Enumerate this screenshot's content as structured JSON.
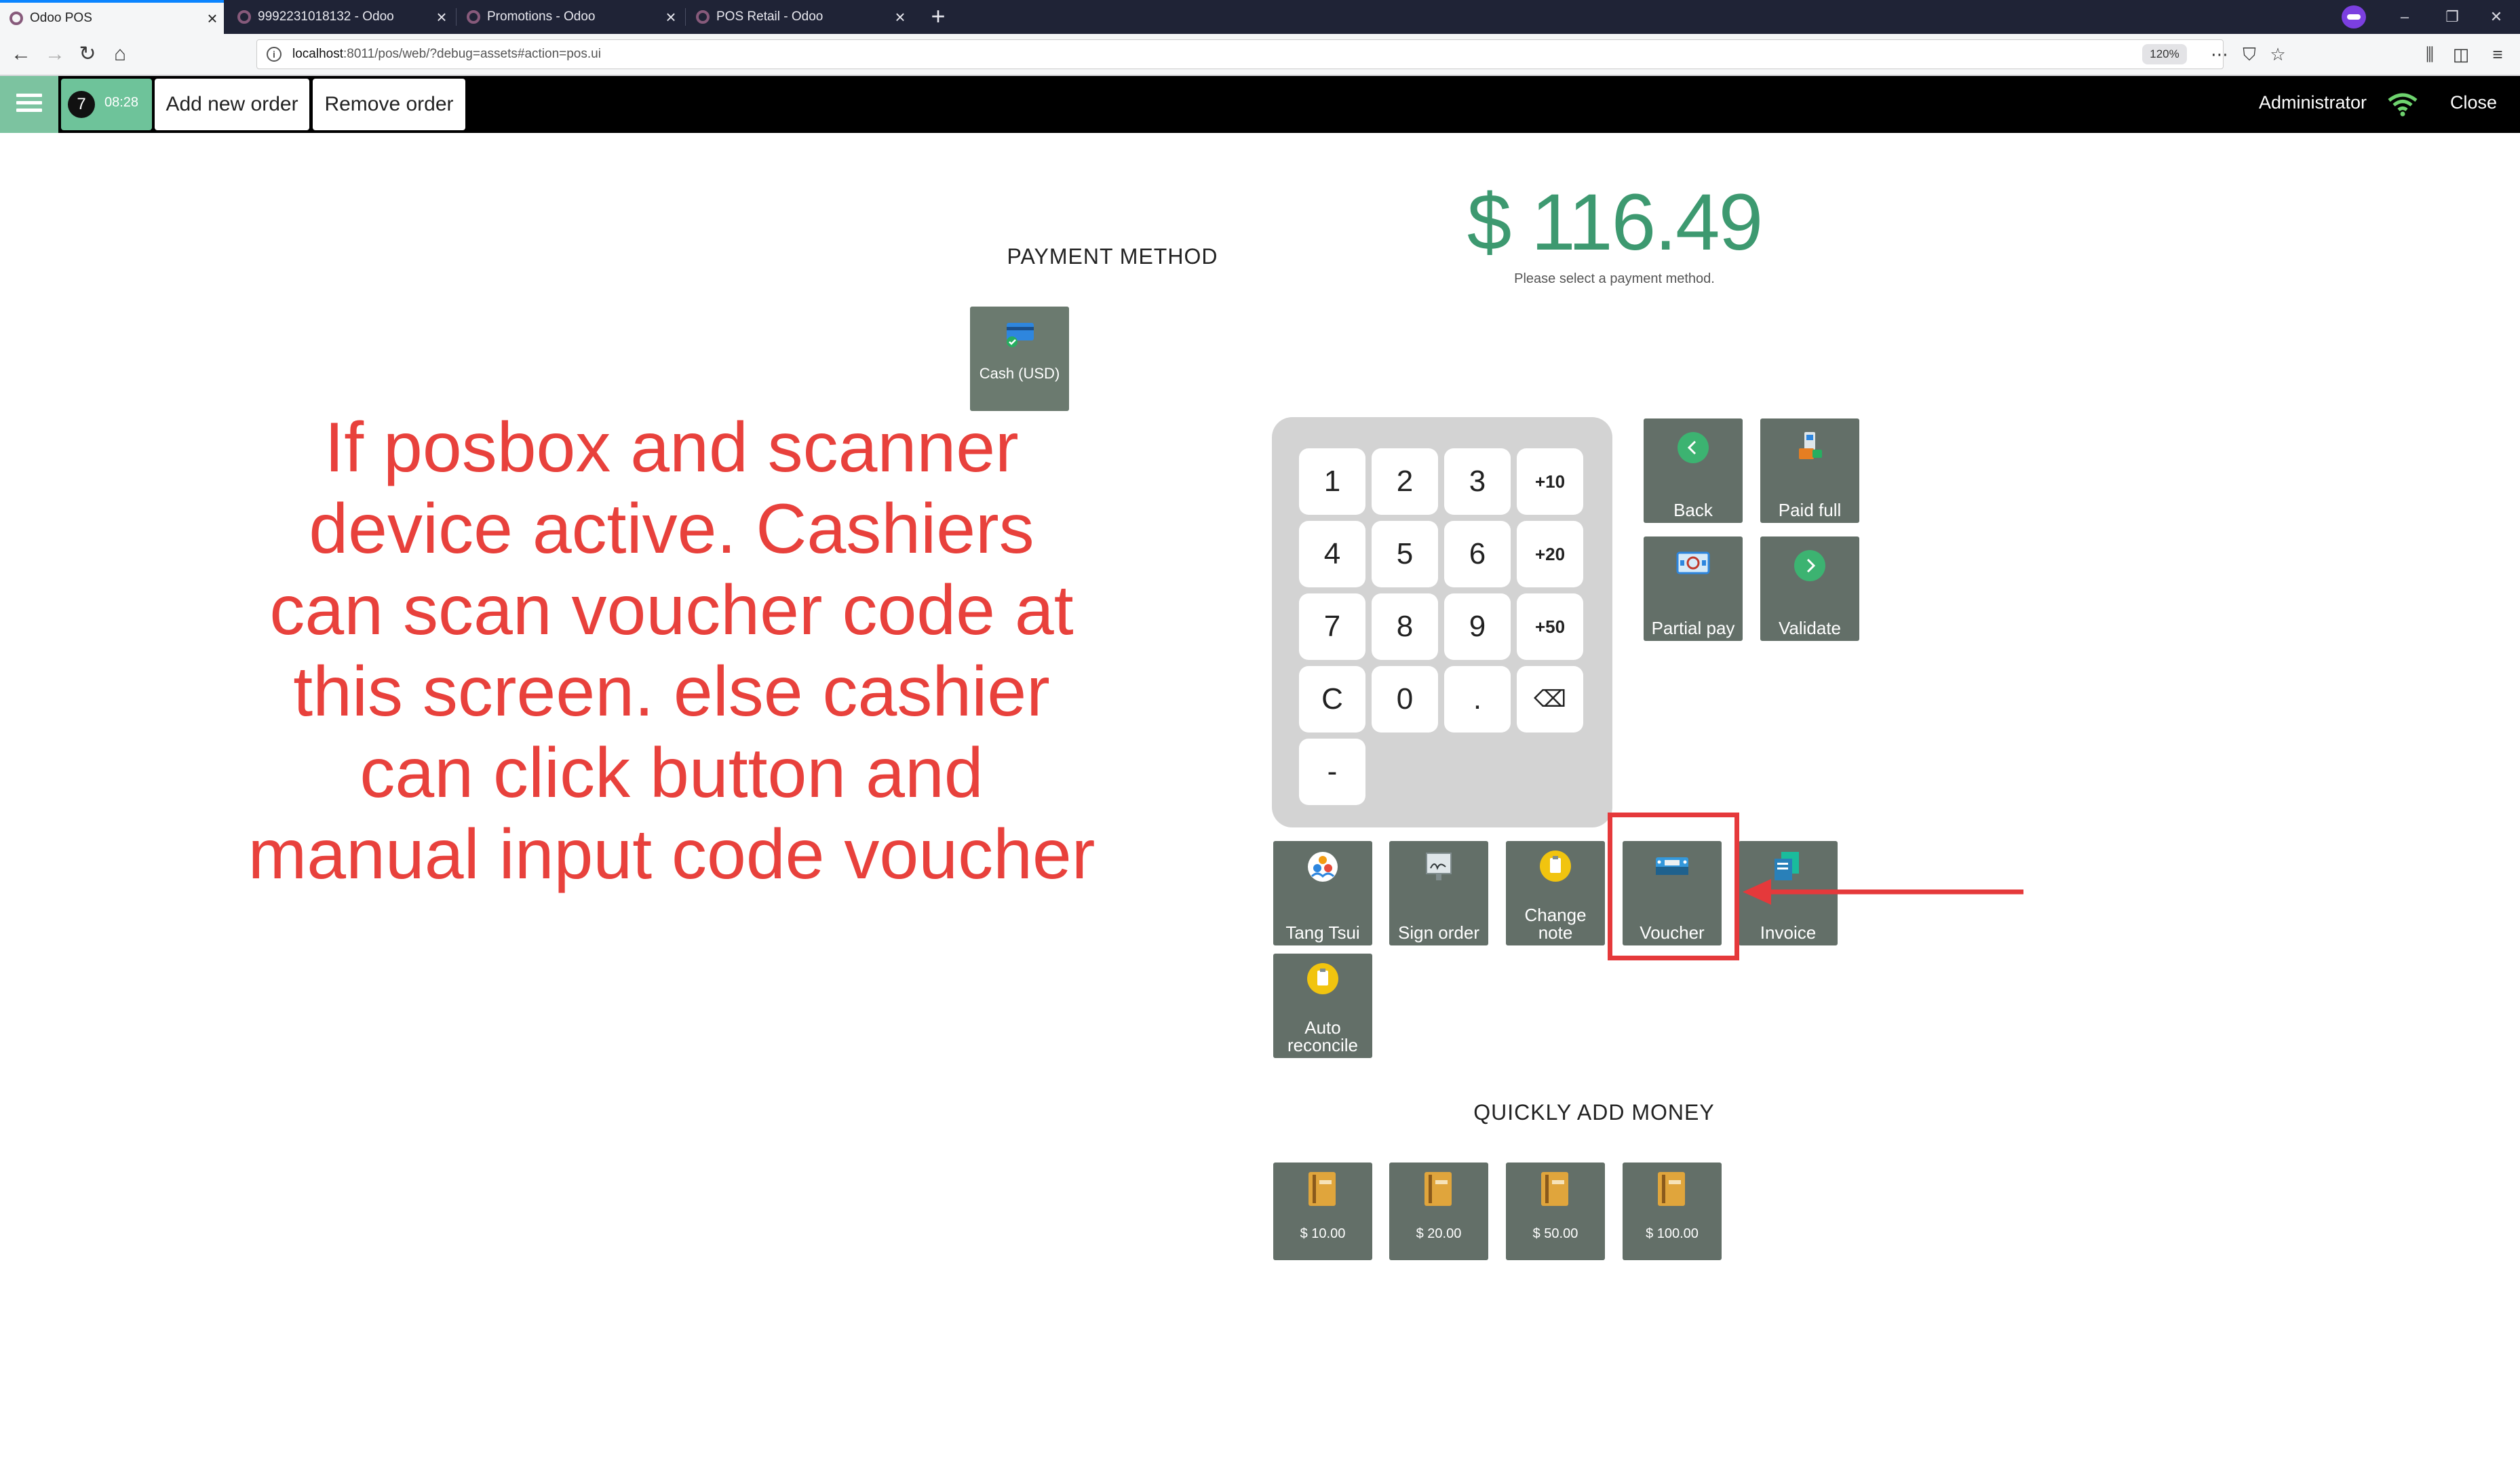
{
  "browser": {
    "tabs": [
      {
        "label": "Odoo POS",
        "active": true
      },
      {
        "label": "9992231018132 - Odoo",
        "active": false
      },
      {
        "label": "Promotions - Odoo",
        "active": false
      },
      {
        "label": "POS Retail - Odoo",
        "active": false
      }
    ],
    "new_tab": "+",
    "url_host": "localhost",
    "url_rest": ":8011/pos/web/?debug=assets#action=pos.ui",
    "zoom": "120%"
  },
  "pos_header": {
    "order_number": "7",
    "order_time": "08:28",
    "add_order_label": "Add new order",
    "remove_order_label": "Remove order",
    "user_name": "Administrator",
    "close_label": "Close"
  },
  "payment": {
    "title": "PAYMENT METHOD",
    "methods": [
      {
        "label": "Cash (USD)"
      }
    ],
    "total": "$ 116.49",
    "hint": "Please select a payment method."
  },
  "numpad": {
    "keys": [
      "1",
      "2",
      "3",
      "+10",
      "4",
      "5",
      "6",
      "+20",
      "7",
      "8",
      "9",
      "+50",
      "C",
      "0",
      ".",
      "⌫",
      "-"
    ]
  },
  "actions": {
    "back": "Back",
    "paid_full": "Paid full",
    "partial_pay": "Partial pay",
    "validate": "Validate",
    "customer": "Tang Tsui",
    "sign_order": "Sign order",
    "change_note_1": "Change",
    "change_note_2": "note",
    "voucher": "Voucher",
    "invoice": "Invoice",
    "auto_reconcile_1": "Auto",
    "auto_reconcile_2": "reconcile"
  },
  "quick_add": {
    "title": "QUICKLY ADD MONEY",
    "amounts": [
      "$ 10.00",
      "$ 20.00",
      "$ 50.00",
      "$ 100.00"
    ]
  },
  "annotation": {
    "lines": [
      "If posbox and scanner",
      "device active. Cashiers",
      "can scan voucher code at",
      "this screen. else cashier",
      "can click button and",
      "manual input code voucher"
    ]
  },
  "colors": {
    "accent_green": "#3d9970",
    "button_gray": "#636f68",
    "annotation_red": "#e8413c",
    "highlight_red": "#e5393b"
  }
}
